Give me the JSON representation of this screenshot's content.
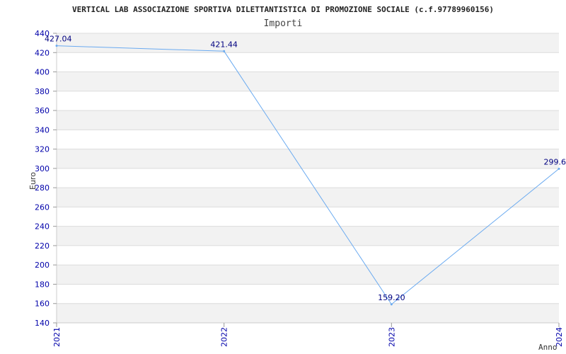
{
  "chart_data": {
    "type": "line",
    "title": "VERTICAL LAB ASSOCIAZIONE SPORTIVA DILETTANTISTICA DI PROMOZIONE SOCIALE (c.f.97789960156)",
    "subtitle": "Importi",
    "xlabel": "Anno",
    "ylabel": "Euro",
    "categories": [
      "2021",
      "2022",
      "2023",
      "2024"
    ],
    "values": [
      427.04,
      421.44,
      159.2,
      299.6
    ],
    "data_labels": [
      "427.04",
      "421.44",
      "159.20",
      "299.6"
    ],
    "ylim": [
      140,
      440
    ],
    "yticks": [
      "140",
      "160",
      "180",
      "200",
      "220",
      "240",
      "260",
      "280",
      "300",
      "320",
      "340",
      "360",
      "380",
      "400",
      "420",
      "440"
    ],
    "grid": true,
    "colors": {
      "line": "#6aaaf0",
      "axis_text": "#0000aa",
      "label_text": "#000080",
      "band": "#f2f2f2",
      "gridline": "#dcdcdc"
    }
  }
}
